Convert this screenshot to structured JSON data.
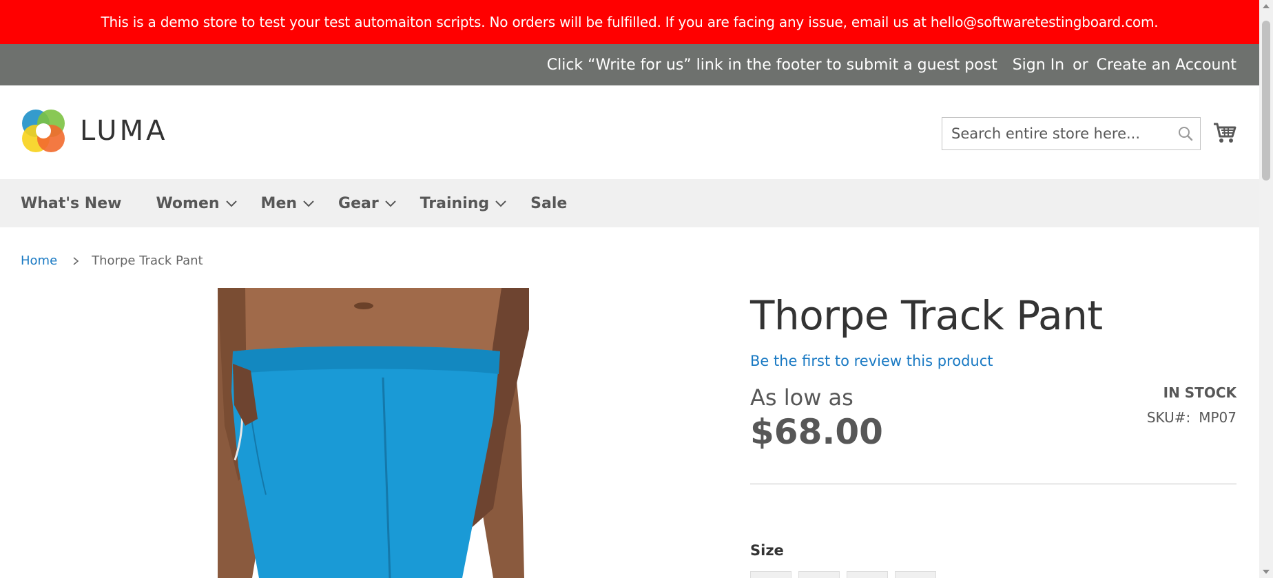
{
  "demo_banner": {
    "text": "This is a demo store to test your test automaiton scripts. No orders will be fulfilled. If you are facing any issue, email us at hello@softwaretestingboard.com.",
    "color": "#ff0000"
  },
  "panel_header": {
    "welcome": "Click “Write for us” link in the footer to submit a guest post",
    "sign_in": "Sign In",
    "or": "or",
    "create_account": "Create an Account"
  },
  "header": {
    "logo_text": "LUMA",
    "search_placeholder": "Search entire store here...",
    "search_icon": "magnifier-icon",
    "cart_icon": "shopping-cart-icon"
  },
  "nav": {
    "items": [
      {
        "label": "What's New",
        "has_dropdown": false
      },
      {
        "label": "Women",
        "has_dropdown": true
      },
      {
        "label": "Men",
        "has_dropdown": true
      },
      {
        "label": "Gear",
        "has_dropdown": true
      },
      {
        "label": "Training",
        "has_dropdown": true
      },
      {
        "label": "Sale",
        "has_dropdown": false
      }
    ]
  },
  "breadcrumbs": {
    "home": "Home",
    "current": "Thorpe Track Pant"
  },
  "product": {
    "title": "Thorpe Track Pant",
    "review_link": "Be the first to review this product",
    "price_prefix": "As low as",
    "price": "$68.00",
    "stock": "IN STOCK",
    "sku_label": "SKU#:",
    "sku": "MP07",
    "size_label": "Size",
    "image_main_color": "#1a9ad6"
  },
  "colors": {
    "link": "#1979c3",
    "panel_header_bg": "#6e716e",
    "nav_bg": "#f0f0f0"
  }
}
